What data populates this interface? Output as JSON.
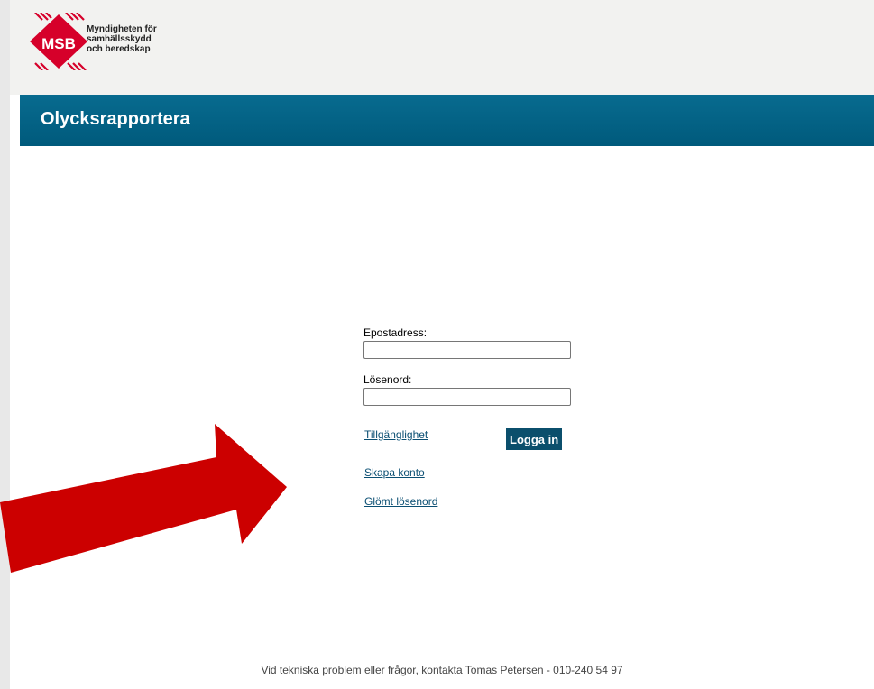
{
  "header": {
    "org_name_line1": "Myndigheten för",
    "org_name_line2": "samhällsskydd",
    "org_name_line3": "och beredskap",
    "logo_abbr": "MSB"
  },
  "app": {
    "title": "Olycksrapportera"
  },
  "login": {
    "email_label": "Epostadress:",
    "email_value": "",
    "password_label": "Lösenord:",
    "password_value": "",
    "accessibility_link": "Tillgänglighet",
    "login_button": "Logga in",
    "create_account_link": "Skapa konto",
    "forgot_password_link": "Glömt lösenord"
  },
  "footer": {
    "contact_text": "Vid tekniska problem eller frågor, kontakta Tomas Petersen - 010-240 54 97"
  },
  "colors": {
    "title_bar": "#005a7c",
    "button": "#0b4f6c",
    "link": "#0b4f73",
    "logo_red": "#d6002a",
    "annotation_arrow": "#cc0000"
  },
  "icons": {
    "logo": "msb-logo-icon",
    "annotation": "arrow-right-icon"
  }
}
